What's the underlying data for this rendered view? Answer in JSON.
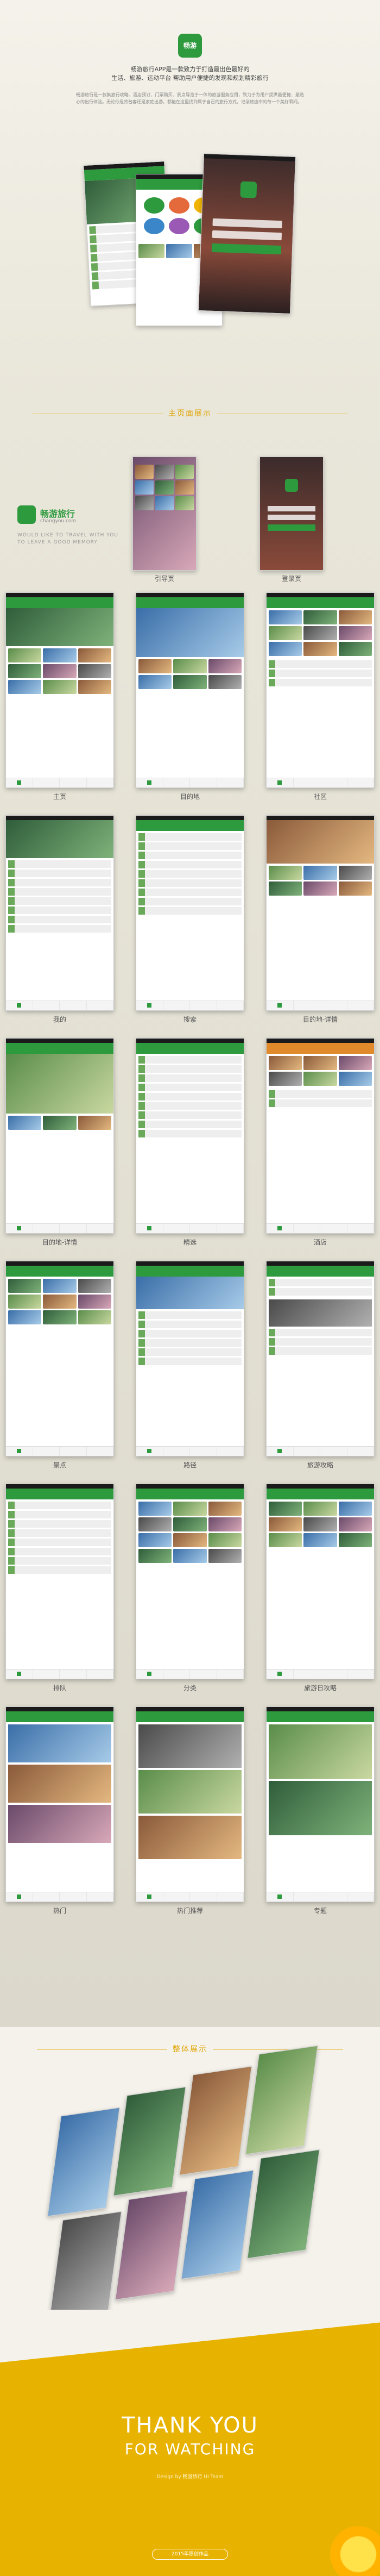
{
  "intro": {
    "app_icon_text": "畅游",
    "headline_line1": "畅游旅行APP是一款致力于打造最出色最好的",
    "headline_line2": "生活、旅游、运动平台 帮助用户便捷的发现和规划精彩旅行",
    "body_text": "畅游旅行是一款集旅行攻略、酒店预订、门票购买、景点导览于一体的旅游服务应用，致力于为用户提供最便捷、最贴心的出行体验。无论你是背包客还是家庭出游，都能在这里找到属于自己的旅行方式，记录旅途中的每一个美好瞬间。"
  },
  "section_title": "主页面展示",
  "brand": {
    "name": "畅游旅行",
    "domain": "changyou.com",
    "slogan_line1": "WOULD LIKE TO TRAVEL WITH YOU",
    "slogan_line2": "TO LEAVE A GOOD MEMORY"
  },
  "screens": {
    "row1": [
      "引导页",
      "登录页"
    ],
    "row2": [
      "主页",
      "目的地",
      "社区"
    ],
    "row3": [
      "我的",
      "搜索",
      "目的地-详情"
    ],
    "row4": [
      "目的地-详情",
      "精选",
      "酒店"
    ],
    "row5": [
      "景点",
      "路径",
      "旅游攻略"
    ],
    "row6": [
      "排队",
      "分类",
      "旅游日攻略"
    ],
    "row7": [
      "热门",
      "热门推荐",
      "专题"
    ]
  },
  "overview_title": "整体展示",
  "thanks": {
    "line1": "THANK YOU",
    "line2": "FOR WATCHING",
    "credit": "Design by 畅游旅行 UI Team",
    "pill": "2015年原创作品"
  },
  "colors": {
    "brand_green": "#2e9a3e",
    "gold": "#e8b200"
  }
}
